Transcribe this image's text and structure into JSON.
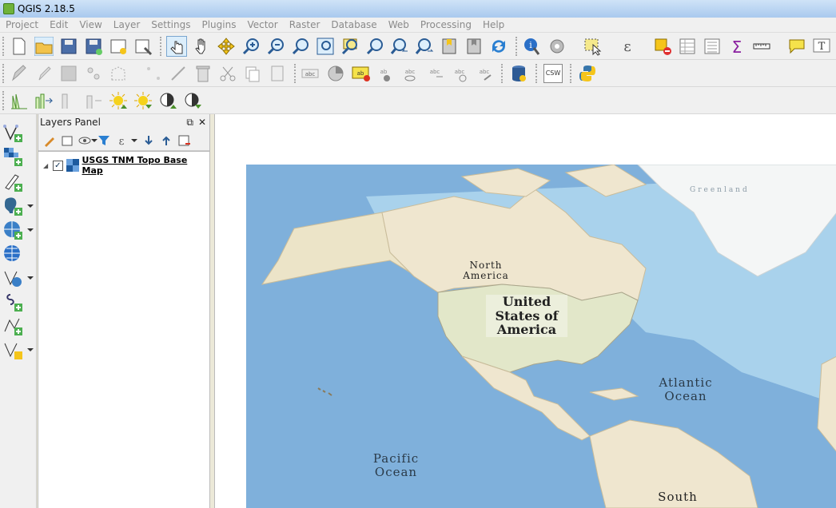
{
  "window": {
    "title": "QGIS 2.18.5"
  },
  "menu": [
    "Project",
    "Edit",
    "View",
    "Layer",
    "Settings",
    "Plugins",
    "Vector",
    "Raster",
    "Database",
    "Web",
    "Processing",
    "Help"
  ],
  "toolbar": {
    "row1": [
      "new-project-icon",
      "open-project-icon",
      "save-project-icon",
      "save-as-icon",
      "new-print-composer-icon",
      "composer-manager-icon",
      "touch-zoom-icon",
      "pan-icon",
      "pan-to-selection-icon",
      "zoom-in-icon",
      "zoom-out-icon",
      "zoom-actual-size-icon",
      "zoom-full-icon",
      "zoom-to-selection-icon",
      "zoom-to-layer-icon",
      "zoom-last-icon",
      "zoom-next-icon",
      "new-bookmark-icon",
      "show-bookmarks-icon",
      "refresh-icon",
      "identify-icon",
      "run-feature-action-icon",
      "select-features-icon",
      "select-by-expression-icon",
      "deselect-icon",
      "open-attribute-table-icon",
      "open-field-calculator-icon",
      "statistical-summary-icon",
      "measure-line-icon",
      "map-tips-icon",
      "text-annotation-icon"
    ],
    "csw_label": "CSW"
  },
  "layers_panel": {
    "title": "Layers Panel",
    "layers": [
      {
        "name": "USGS TNM Topo Base Map",
        "checked": true
      }
    ]
  },
  "map_labels": {
    "greenland": "Greenland",
    "north_america": "North America",
    "usa": "United States of America",
    "atlantic": "Atlantic Ocean",
    "pacific": "Pacific Ocean",
    "south": "South"
  },
  "colors": {
    "ocean": "#7fb0db",
    "land": "#efe6cf",
    "ice": "#f4f6f6",
    "shelf": "#a9d2ec"
  }
}
